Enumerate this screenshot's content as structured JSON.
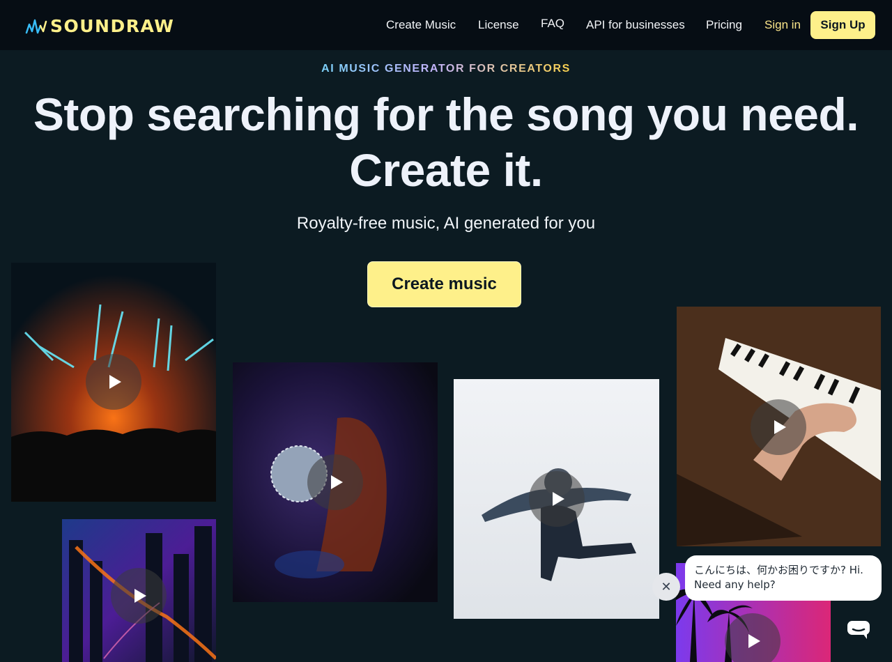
{
  "brand": {
    "name": "SOUNDRAW",
    "accent": "#fef08a",
    "wave_color": "#38bdf8"
  },
  "nav": {
    "items": [
      "Create Music",
      "License",
      "FAQ",
      "API for businesses",
      "Pricing"
    ],
    "signin": "Sign in",
    "signup": "Sign Up"
  },
  "hero": {
    "kicker": "AI MUSIC GENERATOR FOR CREATORS",
    "headline_line1": "Stop searching for the song you need.",
    "headline_line2": "Create it.",
    "subline": "Royalty-free music, AI generated for you",
    "cta": "Create music"
  },
  "tiles": [
    {
      "subject": "concert-light-show"
    },
    {
      "subject": "city-night-aerial"
    },
    {
      "subject": "woman-disco-ball"
    },
    {
      "subject": "breakdancer"
    },
    {
      "subject": "piano-hands"
    },
    {
      "subject": "palm-trees-sunset"
    }
  ],
  "chat": {
    "message_line1": "こんにちは、何かお困りですか? Hi.",
    "message_line2": "Need any help?",
    "close_icon": "close-icon",
    "launcher_icon": "chat-icon"
  }
}
